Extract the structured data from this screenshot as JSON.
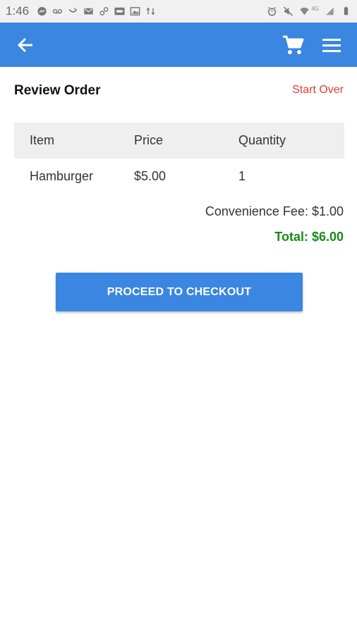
{
  "status_bar": {
    "time": "1:46",
    "left_icons": [
      "messenger-icon",
      "voicemail-icon",
      "missed-call-icon",
      "gmail-icon",
      "link-icon",
      "ebay-icon",
      "gallery-icon",
      "sync-icon"
    ],
    "right_icons": [
      "alarm-icon",
      "mute-icon",
      "wifi-icon",
      "signal-icon",
      "battery-icon"
    ],
    "network_label": "4G"
  },
  "app_bar": {
    "color": "#3a86e0",
    "left_icon": "arrow-back-icon",
    "right_icons": [
      "cart-icon",
      "menu-icon"
    ]
  },
  "page": {
    "title": "Review Order",
    "start_over_label": "Start Over"
  },
  "order_table": {
    "headers": [
      "Item",
      "Price",
      "Quantity"
    ],
    "rows": [
      {
        "item": "Hamburger",
        "price": "$5.00",
        "quantity": "1"
      }
    ]
  },
  "summary": {
    "fee_text": "Convenience Fee: $1.00",
    "total_text": "Total: $6.00",
    "total_color": "#1b8a1b"
  },
  "checkout_button": {
    "label": "PROCEED TO CHECKOUT"
  },
  "colors": {
    "accent": "#3a86e0",
    "link_red": "#e53935"
  }
}
